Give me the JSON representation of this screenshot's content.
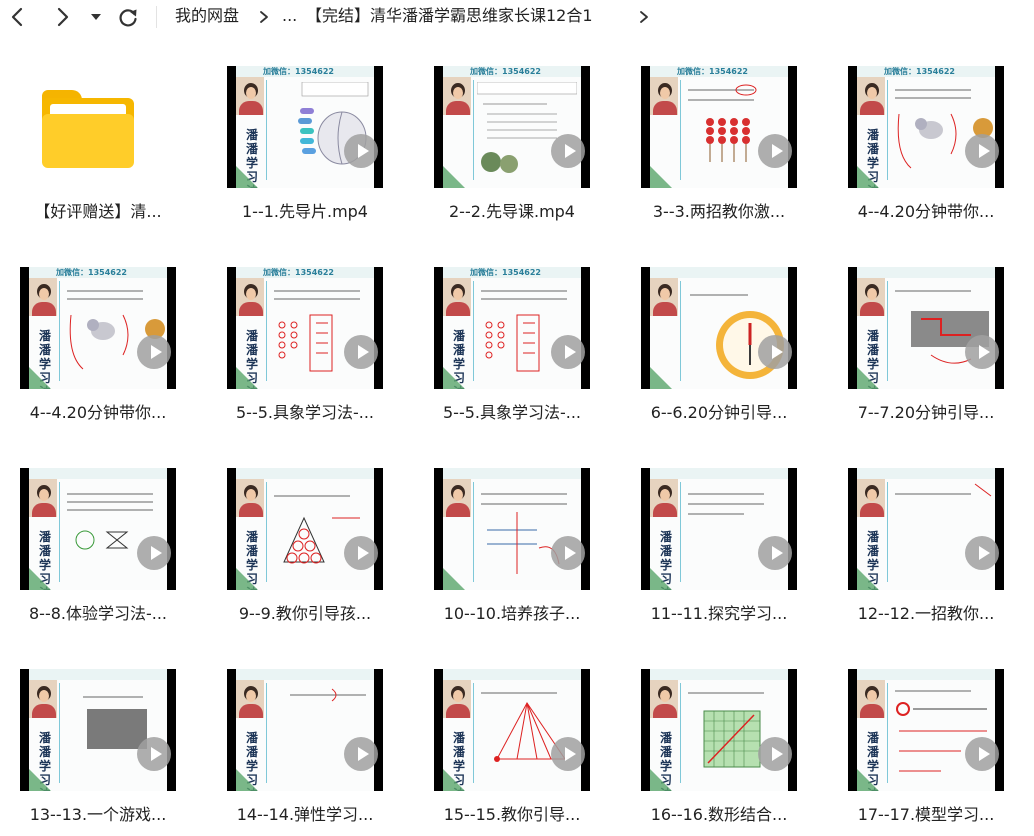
{
  "nav": {
    "back_icon": "chevron-left-icon",
    "forward_icon": "chevron-right-icon",
    "history_icon": "caret-down-icon",
    "refresh_icon": "refresh-icon"
  },
  "breadcrumb": {
    "root": "我的网盘",
    "ellipsis": "...",
    "current": "【完结】清华潘潘学霸思维家长课12合1"
  },
  "watermark": "加微信：1354622",
  "side_text": "潘潘学习法",
  "items": [
    {
      "name": "【好评赠送】清...",
      "type": "folder"
    },
    {
      "name": "1--1.先导片.mp4",
      "type": "video"
    },
    {
      "name": "2--2.先导课.mp4",
      "type": "video"
    },
    {
      "name": "3--3.两招教你激...",
      "type": "video"
    },
    {
      "name": "4--4.20分钟带你...",
      "type": "video"
    },
    {
      "name": "4--4.20分钟带你...",
      "type": "video"
    },
    {
      "name": "5--5.具象学习法-...",
      "type": "video"
    },
    {
      "name": "5--5.具象学习法-...",
      "type": "video"
    },
    {
      "name": "6--6.20分钟引导...",
      "type": "video"
    },
    {
      "name": "7--7.20分钟引导...",
      "type": "video"
    },
    {
      "name": "8--8.体验学习法-...",
      "type": "video"
    },
    {
      "name": "9--9.教你引导孩...",
      "type": "video"
    },
    {
      "name": "10--10.培养孩子...",
      "type": "video"
    },
    {
      "name": "11--11.探究学习...",
      "type": "video"
    },
    {
      "name": "12--12.一招教你...",
      "type": "video"
    },
    {
      "name": "13--13.一个游戏...",
      "type": "video"
    },
    {
      "name": "14--14.弹性学习...",
      "type": "video"
    },
    {
      "name": "15--15.教你引导...",
      "type": "video"
    },
    {
      "name": "16--16.数形结合...",
      "type": "video"
    },
    {
      "name": "17--17.模型学习...",
      "type": "video"
    }
  ]
}
